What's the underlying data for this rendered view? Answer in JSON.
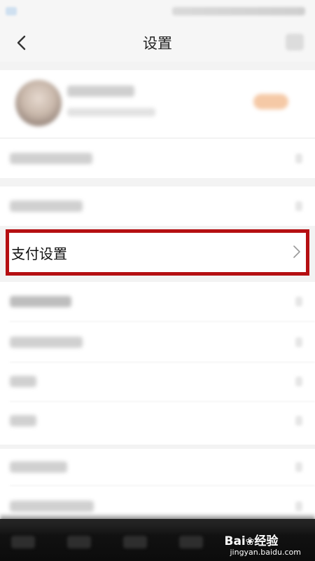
{
  "header": {
    "title": "设置"
  },
  "icons": {
    "back": "chevron-left-icon",
    "chevron": "chevron-right-icon",
    "more": "more-icon"
  },
  "settings_rows": {
    "payment": {
      "label": "支付设置"
    }
  },
  "highlight": {
    "color": "#b50f12"
  },
  "watermark": {
    "brand_prefix": "Bai",
    "brand_suffix": "经验",
    "url": "jingyan.baidu.com"
  }
}
